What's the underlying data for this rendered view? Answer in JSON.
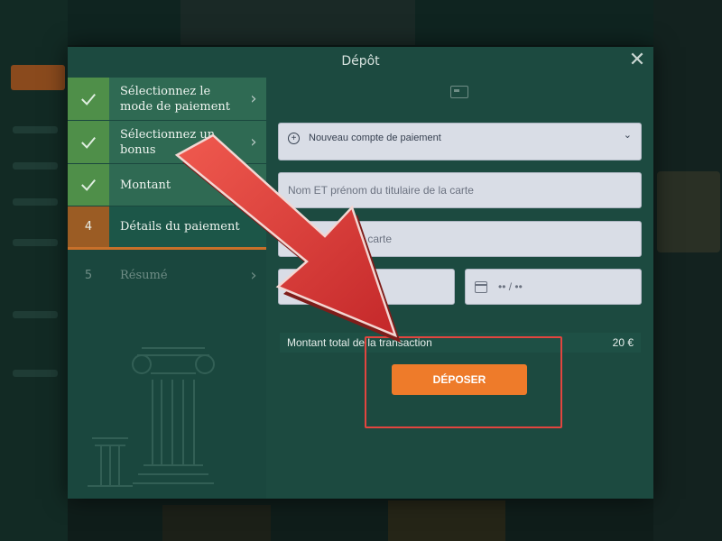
{
  "modal": {
    "title": "Dépôt",
    "close_glyph": "✕"
  },
  "steps": [
    {
      "number": "",
      "label": "Sélectionnez le mode de paiement",
      "status": "done",
      "icon": "check-icon"
    },
    {
      "number": "",
      "label": "Sélectionnez un bonus",
      "status": "done",
      "icon": "check-icon"
    },
    {
      "number": "",
      "label": "Montant",
      "status": "done",
      "icon": "check-icon"
    },
    {
      "number": "4",
      "label": "Détails du paiement",
      "status": "current"
    },
    {
      "number": "5",
      "label": "Résumé",
      "status": "pending"
    }
  ],
  "form": {
    "account_select": "Nouveau compte de paiement",
    "holder_placeholder": "Nom ET prénom du titulaire de la carte",
    "card_number_placeholder": "Numéro de carte",
    "card_number_visible": "éro de carte",
    "expiry_placeholder": "•• / ••",
    "total_label": "Montant total de la transaction",
    "total_value": "20 €",
    "deposit_label": "DÉPOSER"
  },
  "colors": {
    "accent": "#ee7b2a",
    "highlight": "#e2453f",
    "done_step": "#4f8f49",
    "modal_bg": "#1c4a40"
  }
}
